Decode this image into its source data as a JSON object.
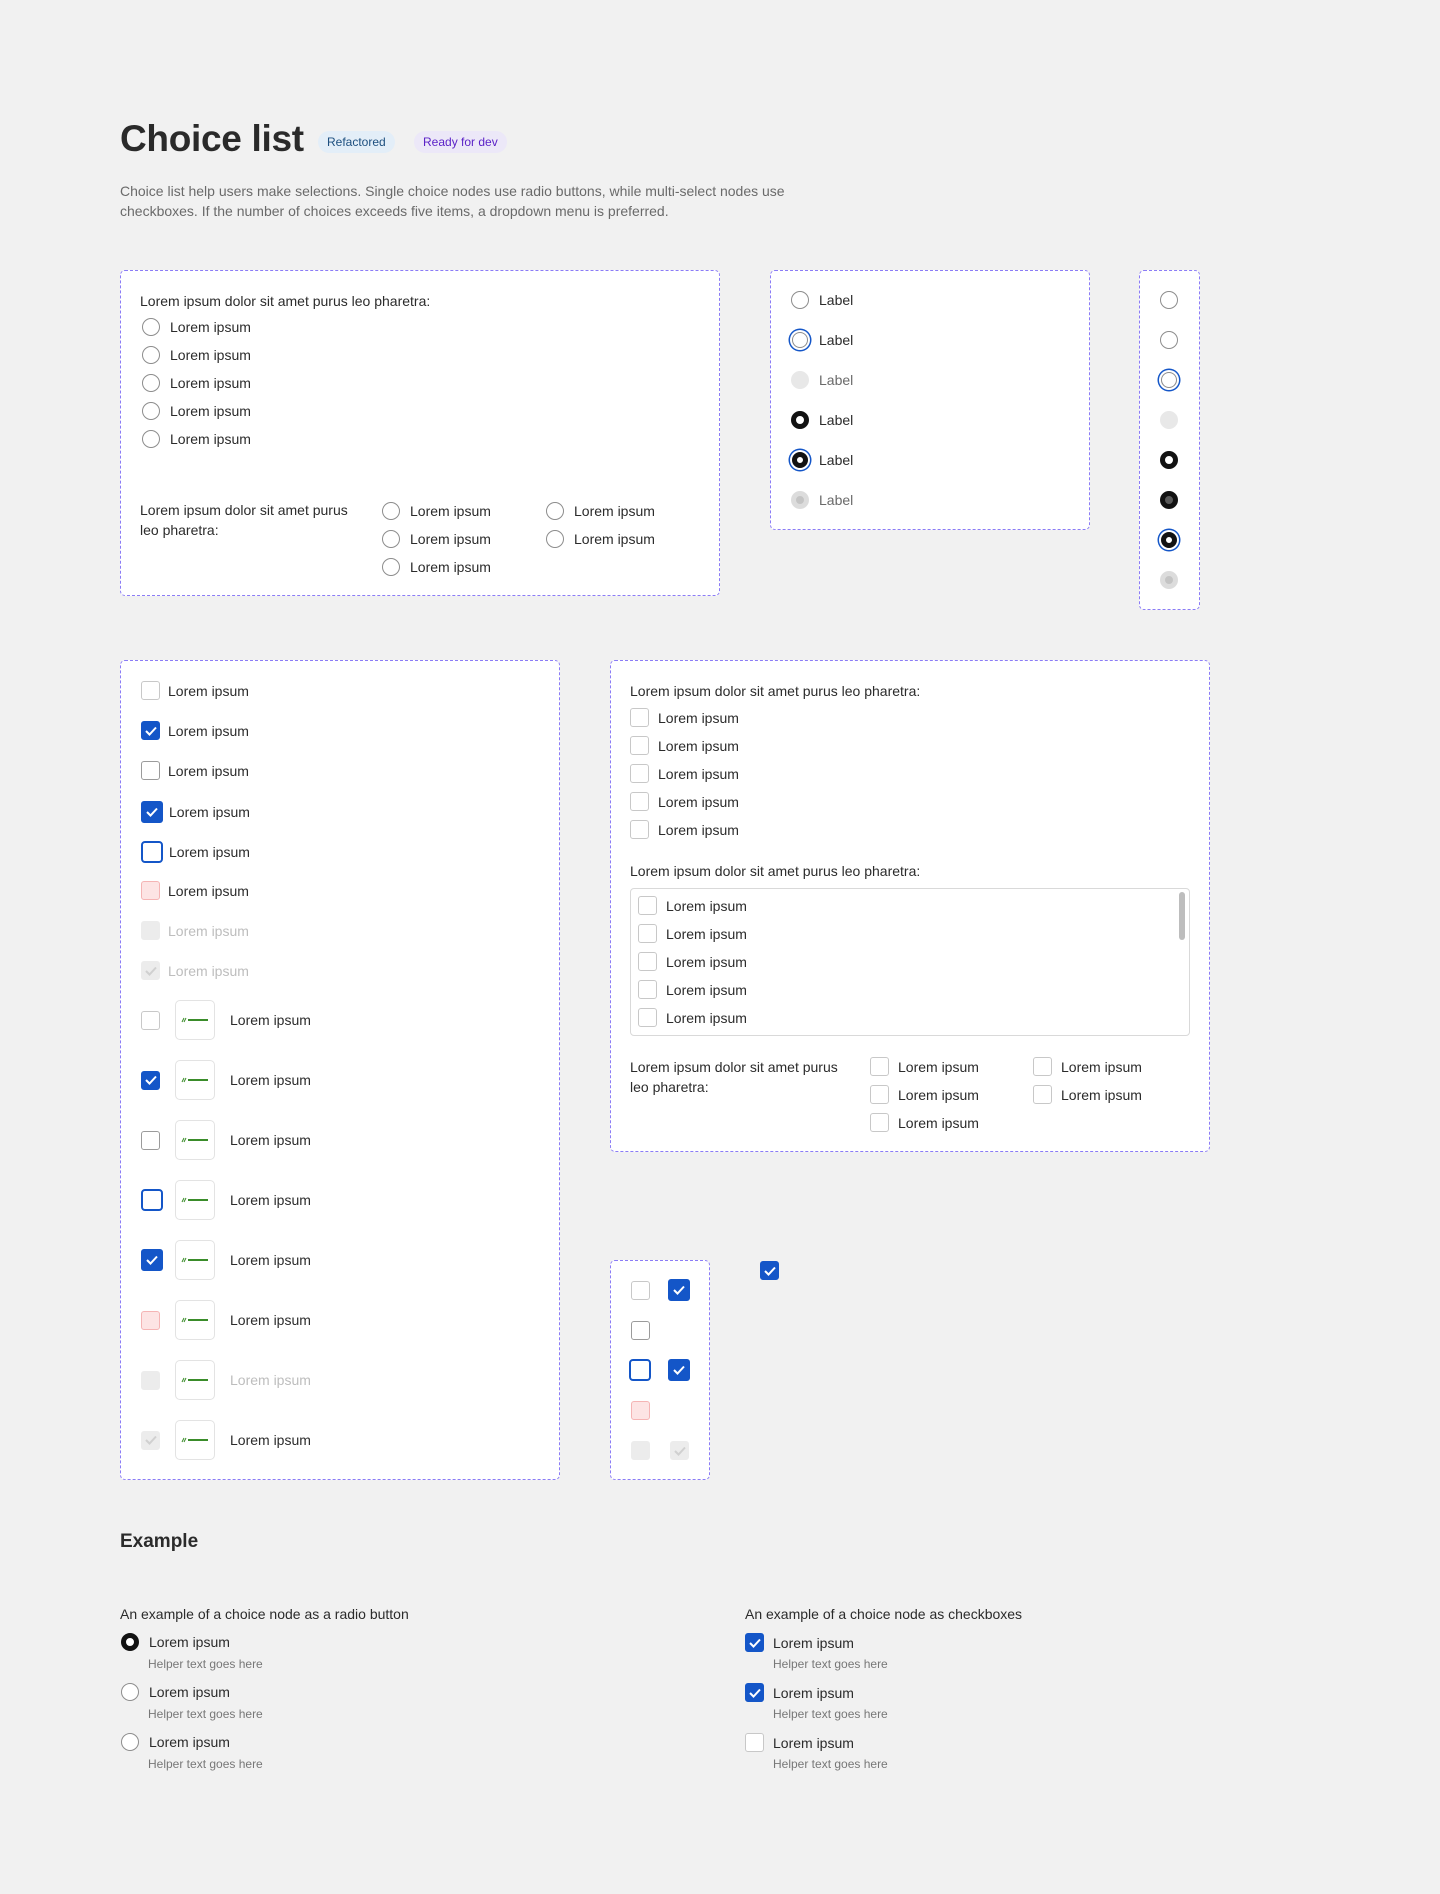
{
  "header": {
    "title": "Choice list",
    "badges": {
      "refactored": "Refactored",
      "ready": "Ready for dev"
    },
    "description": "Choice list help users make selections. Single choice nodes use radio buttons, while multi-select nodes use checkboxes. If the number of choices exceeds five items, a dropdown menu is preferred."
  },
  "radio_list": {
    "question": "Lorem ipsum dolor sit amet purus leo pharetra:",
    "options": [
      "Lorem ipsum",
      "Lorem ipsum",
      "Lorem ipsum",
      "Lorem ipsum",
      "Lorem ipsum"
    ],
    "inline_question": "Lorem ipsum dolor sit amet purus leo pharetra:",
    "inline_col1": [
      "Lorem ipsum",
      "Lorem ipsum",
      "Lorem ipsum"
    ],
    "inline_col2": [
      "Lorem ipsum",
      "Lorem ipsum"
    ]
  },
  "radio_states": {
    "labels": [
      "Label",
      "Label",
      "Label",
      "Label",
      "Label",
      "Label"
    ]
  },
  "checkbox_states": {
    "labels": [
      "Lorem ipsum",
      "Lorem ipsum",
      "Lorem ipsum",
      "Lorem ipsum",
      "Lorem ipsum",
      "Lorem ipsum",
      "Lorem ipsum",
      "Lorem ipsum"
    ],
    "logo_labels": [
      "Lorem ipsum",
      "Lorem ipsum",
      "Lorem ipsum",
      "Lorem ipsum",
      "Lorem ipsum",
      "Lorem ipsum",
      "Lorem ipsum",
      "Lorem ipsum"
    ],
    "logo_text": "logoipsum"
  },
  "checkbox_list": {
    "question1": "Lorem ipsum dolor sit amet purus leo pharetra:",
    "options1": [
      "Lorem ipsum",
      "Lorem ipsum",
      "Lorem ipsum",
      "Lorem ipsum",
      "Lorem ipsum"
    ],
    "question2": "Lorem ipsum dolor sit amet purus leo pharetra:",
    "options2": [
      "Lorem ipsum",
      "Lorem ipsum",
      "Lorem ipsum",
      "Lorem ipsum",
      "Lorem ipsum"
    ],
    "question3": "Lorem ipsum dolor sit amet purus leo pharetra:",
    "inline_col1": [
      "Lorem ipsum",
      "Lorem ipsum",
      "Lorem ipsum"
    ],
    "inline_col2": [
      "Lorem ipsum",
      "Lorem ipsum"
    ]
  },
  "example": {
    "title": "Example",
    "radio_caption": "An example of a choice node as a radio button",
    "radio_items": [
      {
        "label": "Lorem ipsum",
        "helper": "Helper text goes here",
        "selected": true
      },
      {
        "label": "Lorem ipsum",
        "helper": "Helper text goes here",
        "selected": false
      },
      {
        "label": "Lorem ipsum",
        "helper": "Helper text goes here",
        "selected": false
      }
    ],
    "checkbox_caption": "An example of a choice node as checkboxes",
    "checkbox_items": [
      {
        "label": "Lorem ipsum",
        "helper": "Helper text goes here",
        "checked": true
      },
      {
        "label": "Lorem ipsum",
        "helper": "Helper text goes here",
        "checked": true
      },
      {
        "label": "Lorem ipsum",
        "helper": "Helper text goes here",
        "checked": false
      }
    ]
  },
  "colors": {
    "accent": "#1456c8",
    "frame_dash": "#8b7cf6",
    "background": "#f1f1f1",
    "error_fill": "#fde4e4"
  }
}
